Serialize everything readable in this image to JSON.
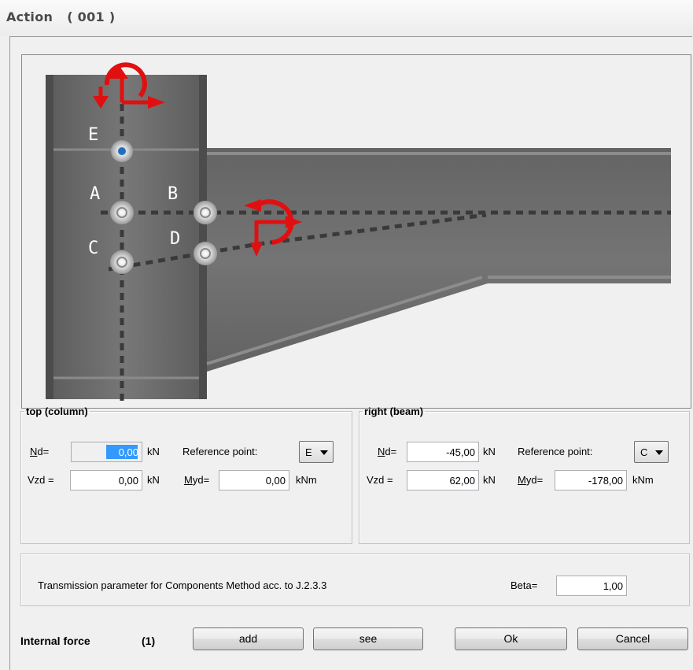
{
  "window": {
    "title": "Action",
    "code": "( 001 )"
  },
  "diagram": {
    "points": [
      "E",
      "A",
      "B",
      "C",
      "D"
    ]
  },
  "top": {
    "legend": "top (column)",
    "nd_label": "Nd=",
    "nd_value": "0,00",
    "nd_unit": "kN",
    "ref_label": "Reference point:",
    "ref_value": "E",
    "vzd_label": "Vzd =",
    "vzd_value": "0,00",
    "vzd_unit": "kN",
    "myd_label": "Myd=",
    "myd_value": "0,00",
    "myd_unit": "kNm"
  },
  "right": {
    "legend": "right (beam)",
    "nd_label": "Nd=",
    "nd_value": "-45,00",
    "nd_unit": "kN",
    "ref_label": "Reference point:",
    "ref_value": "C",
    "vzd_label": "Vzd =",
    "vzd_value": "62,00",
    "vzd_unit": "kN",
    "myd_label": "Myd=",
    "myd_value": "-178,00",
    "myd_unit": "kNm"
  },
  "transmission": {
    "text": "Transmission parameter for Components Method acc. to J.2.3.3",
    "beta_label": "Beta=",
    "beta_value": "1,00"
  },
  "footer": {
    "internal_force_label": "Internal force",
    "internal_force_count": "(1)",
    "add_label": "add",
    "see_label": "see",
    "ok_label": "Ok",
    "cancel_label": "Cancel"
  },
  "colors": {
    "steel": "#6e6e6e",
    "arrow": "#e01010",
    "selection": "#3399ff"
  }
}
